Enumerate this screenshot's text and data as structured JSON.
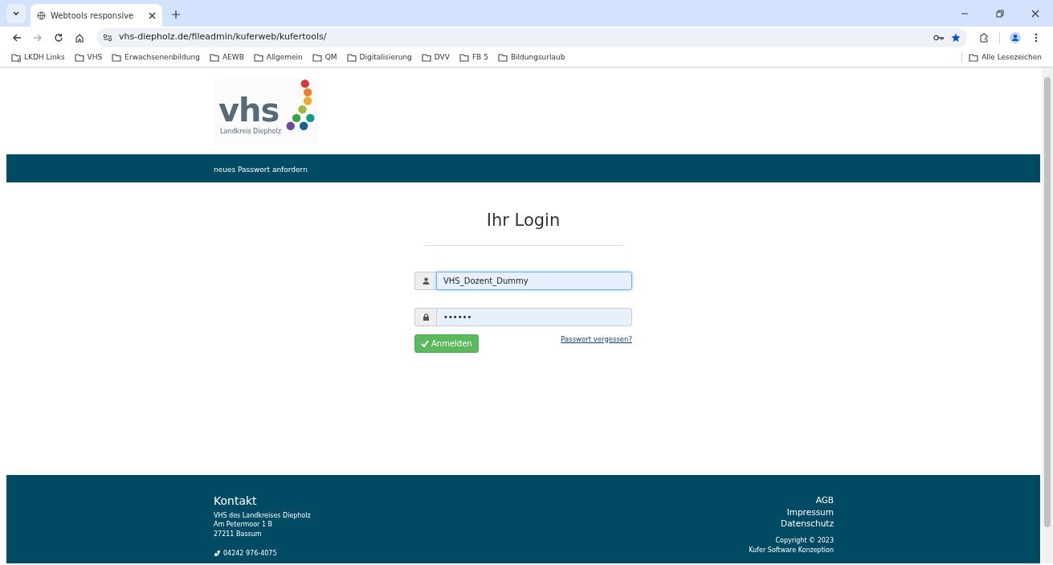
{
  "browser": {
    "tab_title": "Webtools responsive",
    "url": "vhs-diepholz.de/fileadmin/kuferweb/kufertools/",
    "bookmarks": [
      "LKDH Links",
      "VHS",
      "Erwachsenenbildung",
      "AEWB",
      "Allgemein",
      "QM",
      "Digitalisierung",
      "DVV",
      "FB 5",
      "Bildungsurlaub"
    ],
    "all_bookmarks": "Alle Lesezeichen",
    "bookmarked": true
  },
  "logo": {
    "text": "vhs",
    "subtitle": "Landkreis Diepholz"
  },
  "nav": {
    "items": [
      "neues Passwort anfordern"
    ]
  },
  "login": {
    "title": "Ihr Login",
    "username": {
      "value": "VHS_Dozent_Dummy",
      "focused": true
    },
    "password": {
      "value": "••••••",
      "focused": false
    },
    "submit": "Anmelden",
    "forgot_link": "Passwort vergessen?"
  },
  "footer": {
    "heading": "Kontakt",
    "address": [
      "VHS des Landkreises Diepholz",
      "Am Petermoor 1 B",
      "27211 Bassum"
    ],
    "phone": "04242 976-4075",
    "links": [
      "AGB",
      "Impressum",
      "Datenschutz"
    ],
    "copyright": [
      "Copyright © 2023",
      "Kufer Software Konzeption"
    ]
  }
}
